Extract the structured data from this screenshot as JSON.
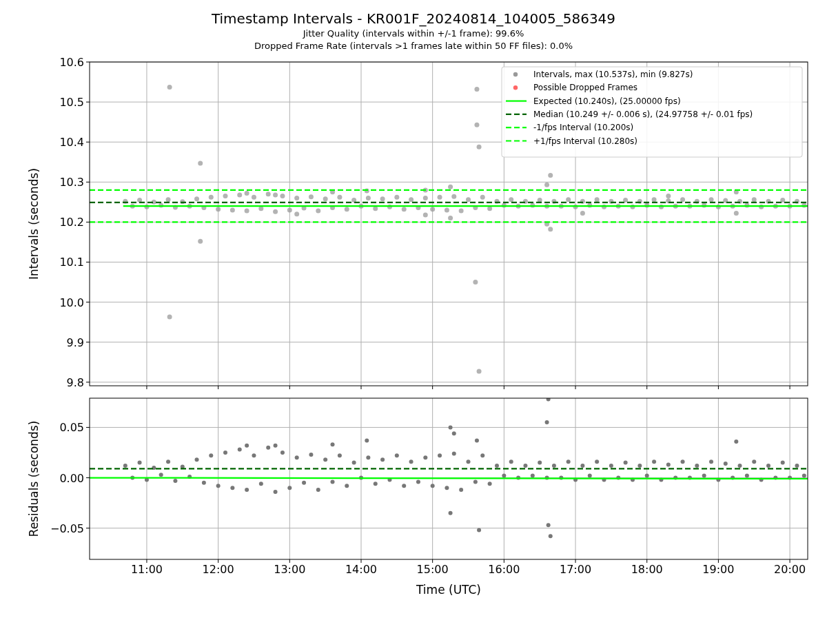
{
  "figure": {
    "title": "Timestamp Intervals - KR001F_20240814_104005_586349",
    "subtitles": [
      "Jitter Quality (intervals within +/-1 frame): 99.6%",
      "Dropped Frame Rate (intervals >1 frames late within 50 FF files): 0.0%"
    ]
  },
  "charts": [
    {
      "chart_data": {
        "type": "scatter",
        "grid": true,
        "legend": true,
        "ylabel": "Intervals (seconds)",
        "xlim": [
          10.2,
          20.25
        ],
        "ylim": [
          9.791,
          10.6
        ],
        "yticks": [
          {
            "value": 9.8,
            "label": "9.8"
          },
          {
            "value": 9.9,
            "label": "9.9"
          },
          {
            "value": 10.0,
            "label": "10.0"
          },
          {
            "value": 10.1,
            "label": "10.1"
          },
          {
            "value": 10.2,
            "label": "10.2"
          },
          {
            "value": 10.3,
            "label": "10.3"
          },
          {
            "value": 10.4,
            "label": "10.4"
          },
          {
            "value": 10.5,
            "label": "10.5"
          },
          {
            "value": 10.6,
            "label": "10.6"
          }
        ],
        "series": [
          {
            "name": "Intervals, max (10.537s), min (9.827s)",
            "color": "#999999",
            "type": "scatter",
            "x": [
              10.7,
              10.8,
              10.9,
              11.0,
              11.1,
              11.2,
              11.3,
              11.4,
              11.5,
              11.6,
              11.7,
              11.8,
              11.9,
              12.0,
              12.1,
              12.2,
              12.3,
              12.4,
              12.5,
              12.6,
              12.7,
              12.8,
              12.9,
              13.0,
              13.1,
              13.2,
              13.3,
              13.4,
              13.5,
              13.6,
              13.7,
              13.8,
              13.9,
              14.0,
              14.1,
              14.2,
              14.3,
              14.4,
              14.5,
              14.6,
              14.7,
              14.8,
              14.9,
              15.0,
              15.1,
              15.2,
              15.3,
              15.4,
              15.5,
              15.6,
              15.7,
              15.8,
              15.9,
              16.0,
              16.1,
              16.2,
              16.3,
              16.4,
              16.5,
              16.6,
              16.7,
              16.8,
              16.9,
              17.0,
              17.1,
              17.2,
              17.3,
              17.4,
              17.5,
              17.6,
              17.7,
              17.8,
              17.9,
              18.0,
              18.1,
              18.2,
              18.3,
              18.4,
              18.5,
              18.6,
              18.7,
              18.8,
              18.9,
              19.0,
              19.1,
              19.2,
              19.3,
              19.4,
              19.5,
              19.6,
              19.7,
              19.8,
              19.9,
              20.0,
              20.1,
              20.2,
              11.32,
              11.32,
              11.75,
              11.75,
              15.62,
              15.62,
              15.65,
              15.6,
              15.65,
              16.65,
              16.6,
              16.65,
              16.6,
              15.25,
              15.25,
              14.9,
              14.9,
              19.25,
              19.25,
              17.1,
              18.3,
              14.08,
              13.6,
              12.4,
              12.8,
              13.1
            ],
            "values": [
              10.252,
              10.24,
              10.255,
              10.238,
              10.25,
              10.242,
              10.256,
              10.237,
              10.251,
              10.24,
              10.258,
              10.236,
              10.262,
              10.232,
              10.265,
              10.23,
              10.268,
              10.228,
              10.262,
              10.234,
              10.27,
              10.226,
              10.265,
              10.23,
              10.26,
              10.235,
              10.263,
              10.228,
              10.258,
              10.236,
              10.262,
              10.232,
              10.255,
              10.24,
              10.26,
              10.234,
              10.258,
              10.238,
              10.262,
              10.232,
              10.256,
              10.236,
              10.26,
              10.232,
              10.262,
              10.23,
              10.264,
              10.228,
              10.256,
              10.236,
              10.262,
              10.234,
              10.252,
              10.242,
              10.256,
              10.24,
              10.252,
              10.242,
              10.255,
              10.24,
              10.252,
              10.24,
              10.256,
              10.238,
              10.252,
              10.242,
              10.256,
              10.238,
              10.252,
              10.24,
              10.255,
              10.238,
              10.252,
              10.242,
              10.256,
              10.238,
              10.253,
              10.24,
              10.256,
              10.24,
              10.252,
              10.242,
              10.256,
              10.238,
              10.254,
              10.24,
              10.252,
              10.242,
              10.256,
              10.238,
              10.252,
              10.24,
              10.255,
              10.24,
              10.252,
              10.242,
              10.537,
              9.963,
              10.347,
              10.152,
              10.532,
              10.443,
              10.388,
              10.05,
              9.827,
              10.317,
              10.293,
              10.182,
              10.195,
              10.288,
              10.21,
              10.28,
              10.218,
              10.275,
              10.222,
              10.222,
              10.265,
              10.278,
              10.275,
              10.272,
              10.268,
              10.22
            ]
          },
          {
            "name": "Possible Dropped Frames",
            "color": "#ff6666",
            "type": "scatter"
          },
          {
            "name": "Expected (10.240s), (25.00000 fps)",
            "color": "#00ff00",
            "type": "line",
            "line_style": "solid",
            "x": [
              10.67,
              20.25
            ],
            "values": [
              10.24,
              10.24
            ]
          },
          {
            "name": "Median (10.249 +/- 0.006 s), (24.97758 +/- 0.01 fps)",
            "color": "#006400",
            "type": "line",
            "line_style": "dashed",
            "x": [
              10.2,
              20.25
            ],
            "values": [
              10.249,
              10.249
            ]
          },
          {
            "name": "-1/fps Interval (10.200s)",
            "color": "#00ff00",
            "type": "line",
            "line_style": "dashed",
            "x": [
              10.2,
              20.25
            ],
            "values": [
              10.2,
              10.2
            ]
          },
          {
            "name": "+1/fps Interval (10.280s)",
            "color": "#00ff00",
            "type": "line",
            "line_style": "dashed",
            "x": [
              10.2,
              20.25
            ],
            "values": [
              10.28,
              10.28
            ]
          }
        ]
      }
    },
    {
      "chart_data": {
        "type": "scatter",
        "grid": true,
        "xlabel": "Time (UTC)",
        "ylabel": "Residuals (seconds)",
        "xlim": [
          10.2,
          20.25
        ],
        "ylim": [
          -0.081,
          0.079
        ],
        "xticks": [
          {
            "value": 11,
            "label": "11:00"
          },
          {
            "value": 12,
            "label": "12:00"
          },
          {
            "value": 13,
            "label": "13:00"
          },
          {
            "value": 14,
            "label": "14:00"
          },
          {
            "value": 15,
            "label": "15:00"
          },
          {
            "value": 16,
            "label": "16:00"
          },
          {
            "value": 17,
            "label": "17:00"
          },
          {
            "value": 18,
            "label": "18:00"
          },
          {
            "value": 19,
            "label": "19:00"
          },
          {
            "value": 20,
            "label": "20:00"
          }
        ],
        "yticks": [
          {
            "value": -0.05,
            "label": "−0.05"
          },
          {
            "value": 0,
            "label": "0.00"
          },
          {
            "value": 0.05,
            "label": "0.05"
          }
        ],
        "series": [
          {
            "color": "#777777",
            "type": "scatter",
            "x": [
              10.7,
              10.8,
              10.9,
              11.0,
              11.1,
              11.2,
              11.3,
              11.4,
              11.5,
              11.6,
              11.7,
              11.8,
              11.9,
              12.0,
              12.1,
              12.2,
              12.3,
              12.4,
              12.5,
              12.6,
              12.7,
              12.8,
              12.9,
              13.0,
              13.1,
              13.2,
              13.3,
              13.4,
              13.5,
              13.6,
              13.7,
              13.8,
              13.9,
              14.0,
              14.1,
              14.2,
              14.3,
              14.4,
              14.5,
              14.6,
              14.7,
              14.8,
              14.9,
              15.0,
              15.1,
              15.2,
              15.3,
              15.4,
              15.5,
              15.6,
              15.7,
              15.8,
              15.9,
              16.0,
              16.1,
              16.2,
              16.3,
              16.4,
              16.5,
              16.6,
              16.7,
              16.8,
              16.9,
              17.0,
              17.1,
              17.2,
              17.3,
              17.4,
              17.5,
              17.6,
              17.7,
              17.8,
              17.9,
              18.0,
              18.1,
              18.2,
              18.3,
              18.4,
              18.5,
              18.6,
              18.7,
              18.8,
              18.9,
              19.0,
              19.1,
              19.2,
              19.3,
              19.4,
              19.5,
              19.6,
              19.7,
              19.8,
              19.9,
              20.0,
              20.1,
              20.2,
              15.25,
              15.25,
              16.62,
              16.6,
              16.62,
              16.65,
              15.65,
              15.62,
              19.25,
              14.08,
              12.4,
              12.8,
              13.6,
              15.3
            ],
            "values": [
              0.012,
              0.0,
              0.015,
              -0.002,
              0.01,
              0.003,
              0.016,
              -0.003,
              0.011,
              0.001,
              0.018,
              -0.005,
              0.022,
              -0.008,
              0.025,
              -0.01,
              0.028,
              -0.012,
              0.022,
              -0.006,
              0.03,
              -0.014,
              0.025,
              -0.01,
              0.02,
              -0.005,
              0.023,
              -0.012,
              0.018,
              -0.004,
              0.022,
              -0.008,
              0.015,
              0.0,
              0.02,
              -0.006,
              0.018,
              -0.002,
              0.022,
              -0.008,
              0.016,
              -0.004,
              0.02,
              -0.008,
              0.022,
              -0.01,
              0.024,
              -0.012,
              0.016,
              -0.004,
              0.022,
              -0.006,
              0.012,
              0.002,
              0.016,
              0.0,
              0.012,
              0.002,
              0.015,
              0.0,
              0.012,
              0.0,
              0.016,
              -0.002,
              0.012,
              0.002,
              0.016,
              -0.002,
              0.012,
              0.0,
              0.015,
              -0.002,
              0.012,
              0.002,
              0.016,
              -0.002,
              0.013,
              0.0,
              0.016,
              0.0,
              0.012,
              0.002,
              0.016,
              -0.002,
              0.014,
              0.0,
              0.012,
              0.002,
              0.016,
              -0.002,
              0.012,
              0.0,
              0.015,
              0.0,
              0.012,
              0.002,
              0.05,
              -0.035,
              0.078,
              0.055,
              -0.047,
              -0.058,
              -0.052,
              0.037,
              0.036,
              0.037,
              0.032,
              0.032,
              0.033,
              0.044
            ]
          },
          {
            "color": "#006400",
            "type": "line",
            "line_style": "dashed",
            "x": [
              10.2,
              20.25
            ],
            "values": [
              0.009,
              0.009
            ]
          },
          {
            "color": "#00ff00",
            "type": "line",
            "line_style": "solid",
            "x": [
              10.2,
              20.25
            ],
            "values": [
              0.0,
              -0.001
            ]
          }
        ]
      }
    }
  ]
}
